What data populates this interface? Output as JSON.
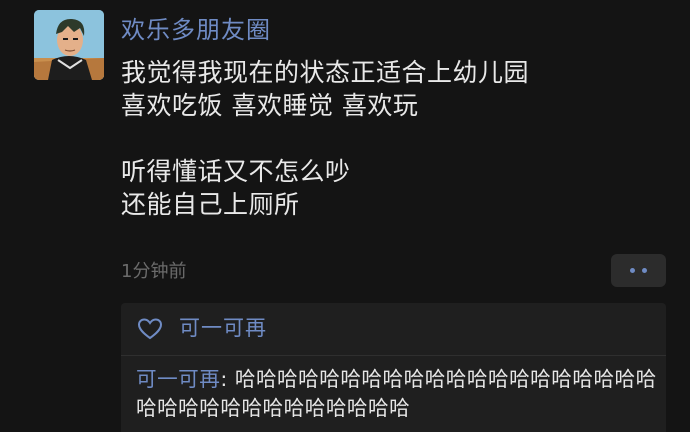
{
  "post": {
    "author": "欢乐多朋友圈",
    "lines": [
      "我觉得我现在的状态正适合上幼儿园",
      "喜欢吃饭 喜欢睡觉 喜欢玩",
      "",
      "听得懂话又不怎么吵",
      "还能自己上厕所"
    ],
    "timestamp": "1分钟前"
  },
  "icons": {
    "avatar": "anime-character-avatar",
    "more": "more-dots-icon",
    "like": "heart-icon"
  },
  "likes": {
    "names": "可一可再"
  },
  "comment": {
    "author": "可一可再",
    "separator": ": ",
    "text": "哈哈哈哈哈哈哈哈哈哈哈哈哈哈哈哈哈哈哈哈哈哈哈哈哈哈哈哈哈哈哈哈哈"
  },
  "colors": {
    "background": "#141414",
    "name_blue": "#6f8bc4",
    "panel": "#1f1f1f",
    "muted": "#6b6b6b"
  }
}
